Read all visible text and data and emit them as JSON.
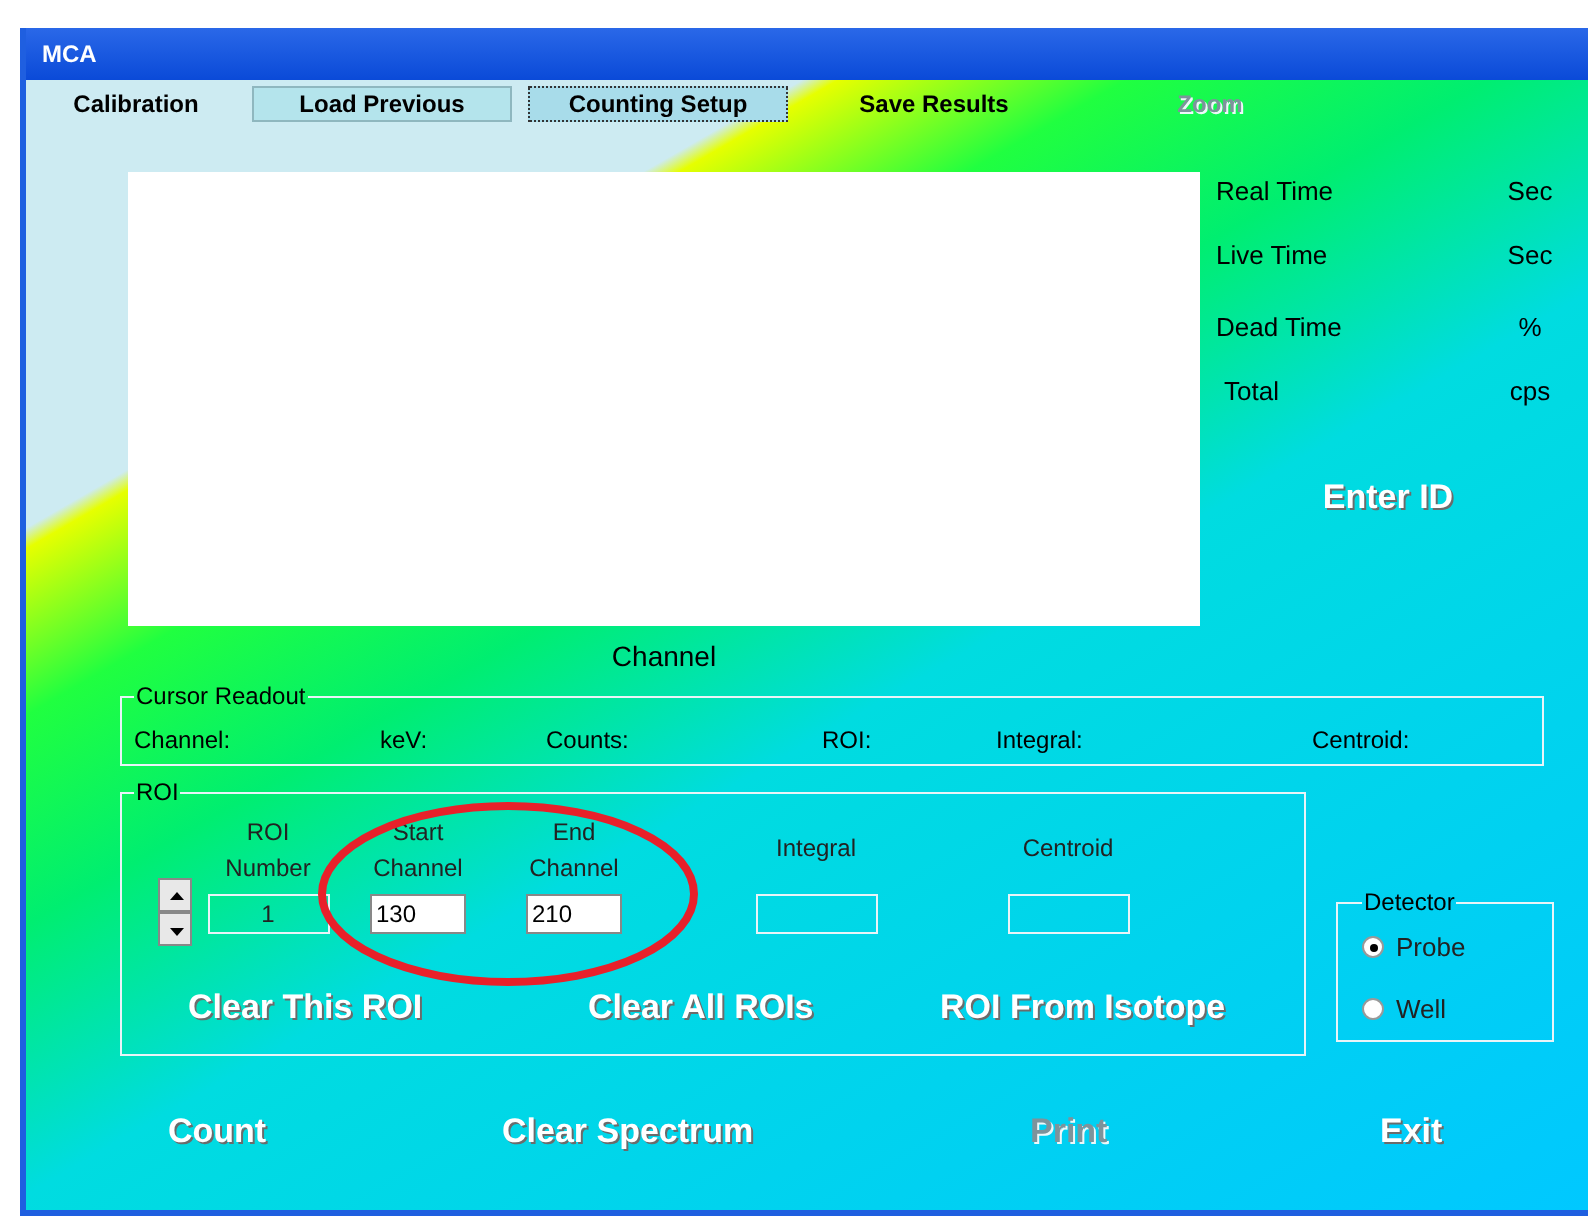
{
  "window": {
    "title": "MCA"
  },
  "toolbar": [
    {
      "label": "Calibration",
      "kind": "flat",
      "disabled": false
    },
    {
      "label": "Load Previous",
      "kind": "raised",
      "disabled": false
    },
    {
      "label": "Counting Setup",
      "kind": "focused",
      "disabled": false
    },
    {
      "label": "Save Results",
      "kind": "flat",
      "disabled": false
    },
    {
      "label": "Zoom",
      "kind": "flat",
      "disabled": true
    }
  ],
  "plot": {
    "xlabel": "Channel"
  },
  "timers": [
    {
      "label": "Real Time",
      "unit": "Sec"
    },
    {
      "label": "Live Time",
      "unit": "Sec"
    },
    {
      "label": "Dead Time",
      "unit": "%"
    },
    {
      "label": "Total",
      "unit": "cps"
    }
  ],
  "enter_id": "Enter ID",
  "cursor_readout": {
    "title": "Cursor Readout",
    "fields": [
      "Channel:",
      "keV:",
      "Counts:",
      "ROI:",
      "Integral:",
      "Centroid:"
    ]
  },
  "roi": {
    "title": "ROI",
    "number_label": "ROI Number",
    "number": "1",
    "start_label": "Start Channel",
    "start": "130",
    "end_label": "End Channel",
    "end": "210",
    "integral_label": "Integral",
    "centroid_label": "Centroid",
    "buttons": [
      {
        "label": "Clear This ROI",
        "disabled": false
      },
      {
        "label": "Clear All ROIs",
        "disabled": false
      },
      {
        "label": "ROI From Isotope",
        "disabled": false
      }
    ]
  },
  "detector": {
    "title": "Detector",
    "options": [
      {
        "label": "Probe",
        "selected": true
      },
      {
        "label": "Well",
        "selected": false
      }
    ]
  },
  "actions": [
    {
      "label": "Count",
      "disabled": false
    },
    {
      "label": "Clear Spectrum",
      "disabled": false
    },
    {
      "label": "Print",
      "disabled": true
    },
    {
      "label": "Exit",
      "disabled": false
    }
  ]
}
